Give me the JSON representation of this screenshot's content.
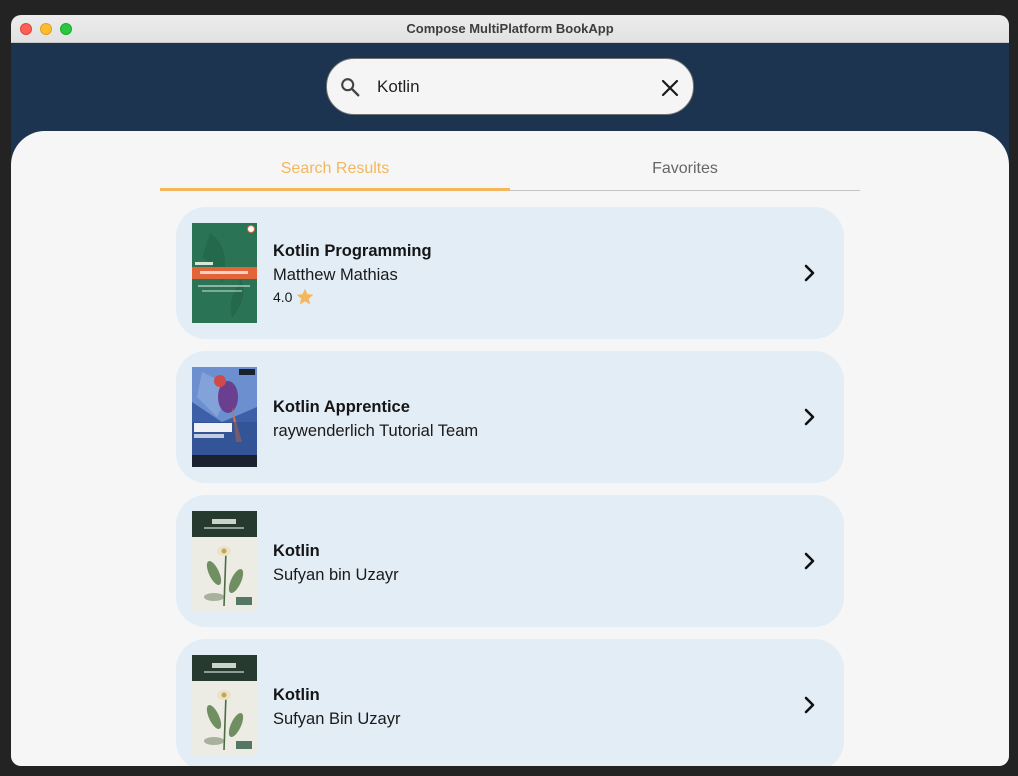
{
  "window": {
    "title": "Compose MultiPlatform BookApp"
  },
  "search": {
    "value": "Kotlin",
    "placeholder": ""
  },
  "tabs": [
    {
      "label": "Search Results",
      "active": true
    },
    {
      "label": "Favorites",
      "active": false
    }
  ],
  "books": [
    {
      "title": "Kotlin Programming",
      "author": "Matthew Mathias",
      "rating": "4.0",
      "cover": "kotlin-programming-cover"
    },
    {
      "title": "Kotlin Apprentice",
      "author": "raywenderlich Tutorial Team",
      "cover": "kotlin-apprentice-cover"
    },
    {
      "title": "Kotlin",
      "author": "Sufyan bin Uzayr",
      "cover": "kotlin-botanical-cover"
    },
    {
      "title": "Kotlin",
      "author": "Sufyan Bin Uzayr",
      "cover": "kotlin-botanical-cover"
    }
  ],
  "colors": {
    "header": "#1c344f",
    "accent": "#f4b75d",
    "card": "#e3edf6",
    "background": "#f6f6f6"
  },
  "icons": {
    "search": "search-icon",
    "clear": "close-icon",
    "star": "star-icon",
    "chevron": "chevron-right-icon"
  }
}
